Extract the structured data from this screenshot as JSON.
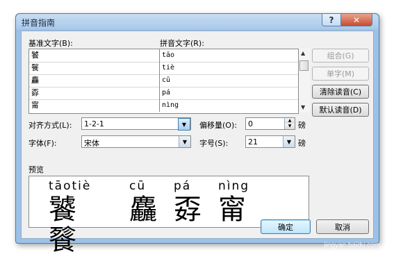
{
  "window": {
    "title": "拼音指南",
    "help": "?",
    "close": "✕"
  },
  "labels": {
    "base_text": "基准文字(B):",
    "pinyin_text": "拼音文字(R):"
  },
  "rows": [
    {
      "base": "饕",
      "pinyin": "tāo"
    },
    {
      "base": "餮",
      "pinyin": "tiè"
    },
    {
      "base": "麤",
      "pinyin": "cū"
    },
    {
      "base": "孬",
      "pinyin": "pá"
    },
    {
      "base": "甯",
      "pinyin": "nìng"
    }
  ],
  "buttons": {
    "group": "组合(G)",
    "single": "单字(M)",
    "clear": "清除读音(C)",
    "default_reading": "默认读音(D)",
    "ok": "确定",
    "cancel": "取消"
  },
  "options": {
    "align_label": "对齐方式(L):",
    "align_value": "1-2-1",
    "offset_label": "偏移量(O):",
    "offset_value": "0",
    "offset_unit": "磅",
    "font_label": "字体(F):",
    "font_value": "宋体",
    "size_label": "字号(S):",
    "size_value": "21",
    "size_unit": "磅"
  },
  "preview": {
    "label": "预览",
    "pinyin_1": "tāotiè",
    "pinyin_2": "cū",
    "pinyin_3": "pá",
    "pinyin_4": "nìng",
    "chars_1": "饕餮",
    "chars_2": "麤",
    "chars_3": "孬",
    "chars_4": "甯"
  },
  "watermark": "jingyan.baidu.com"
}
